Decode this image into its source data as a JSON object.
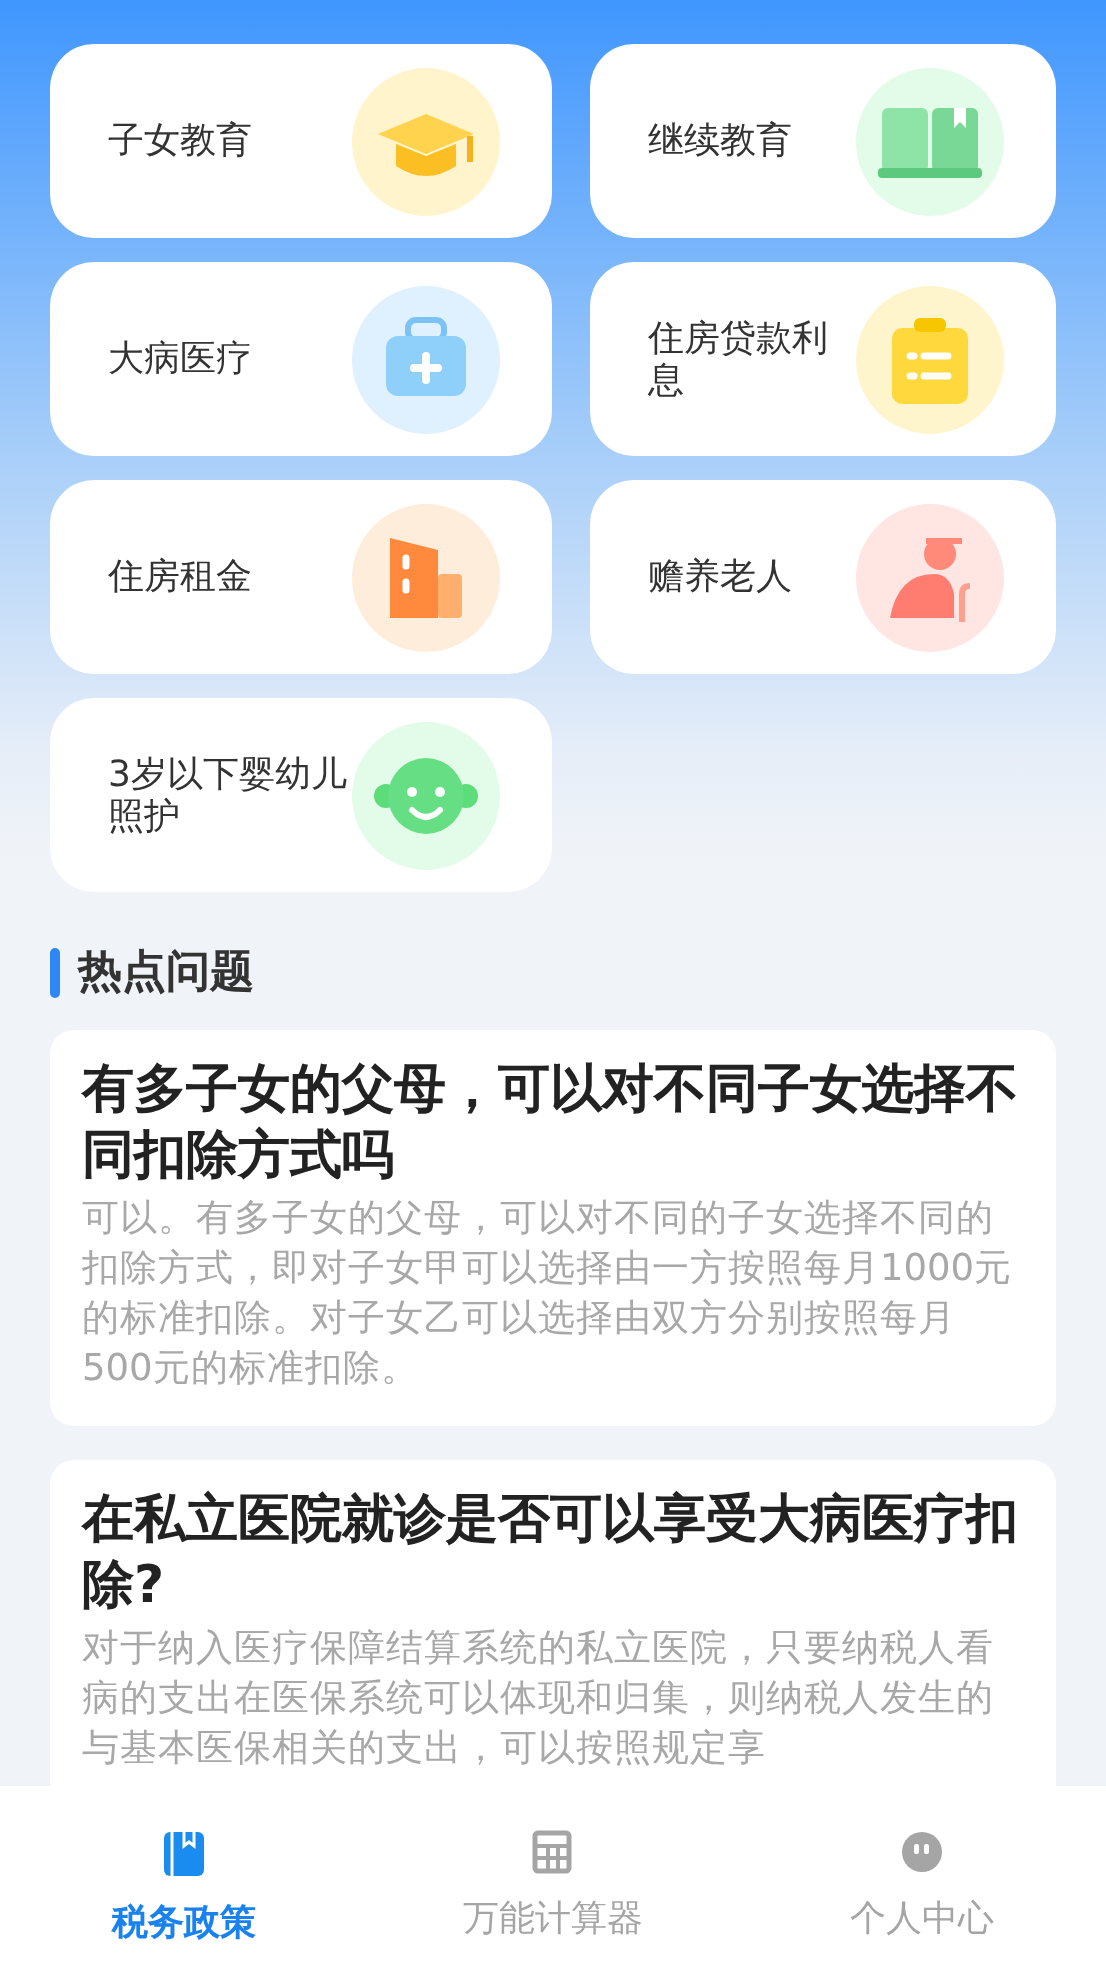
{
  "categories": [
    {
      "label": "子女教育"
    },
    {
      "label": "继续教育"
    },
    {
      "label": "大病医疗"
    },
    {
      "label": "住房贷款利息"
    },
    {
      "label": "住房租金"
    },
    {
      "label": "赡养老人"
    },
    {
      "label": "3岁以下婴幼儿照护"
    }
  ],
  "hot_questions": {
    "title": "热点问题",
    "items": [
      {
        "question": "有多子女的父母，可以对不同子女选择不同扣除方式吗",
        "answer": "可以。有多子女的父母，可以对不同的子女选择不同的扣除方式，即对子女甲可以选择由一方按照每月1000元的标准扣除。对子女乙可以选择由双方分别按照每月500元的标准扣除。"
      },
      {
        "question": "在私立医院就诊是否可以享受大病医疗扣除?",
        "answer": "对于纳入医疗保障结算系统的私立医院，只要纳税人看病的支出在医保系统可以体现和归集，则纳税人发生的与基本医保相关的支出，可以按照规定享"
      }
    ]
  },
  "tab_bar": [
    {
      "label": "税务政策",
      "selected": true
    },
    {
      "label": "万能计算器",
      "selected": false
    },
    {
      "label": "个人中心",
      "selected": false
    }
  ]
}
